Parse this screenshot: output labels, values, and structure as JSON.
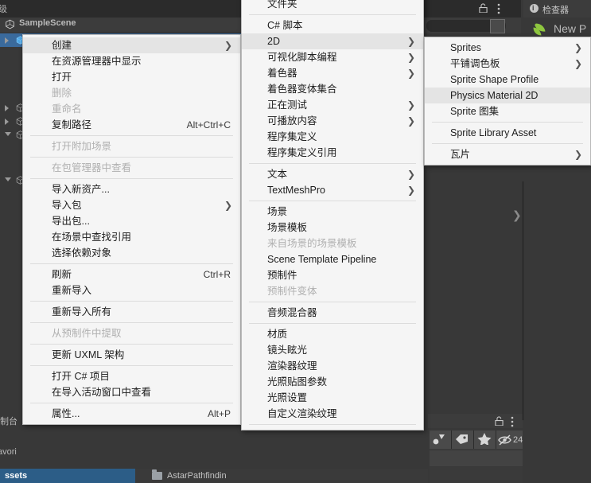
{
  "editor": {
    "left_tab_label": "级",
    "hierarchy": {
      "scene_name": "SampleScene",
      "scene_icon": "unity-logo-icon"
    },
    "inspector": {
      "tab_label": "检查器",
      "asset_name": "New P",
      "info_icon": "info-icon",
      "asset_icon": "sprite-asset-icon"
    },
    "project": {
      "hidden_count": "24",
      "lock_icon": "unlock-icon",
      "menu_icon": "kebab-menu-icon"
    },
    "breadcrumb": {
      "root": "ssets",
      "folder": "AstarPathfindin"
    },
    "console_label": "制台",
    "favorites_label": "avori"
  },
  "colors": {
    "menu_bg": "#f5f5f5",
    "menu_highlight": "#e4e4e4",
    "menu_border": "#b9b9b9",
    "editor_bg": "#383838",
    "panel_header": "#3c3c3c",
    "selection_blue": "#3a6a9c",
    "breadcrumb_blue": "#2c5d87",
    "accent_green": "#a6e22e"
  },
  "menu_assets": {
    "name": "assets-context-menu",
    "items": [
      {
        "label": "创建",
        "shortcut": "",
        "arrow": true,
        "disabled": false,
        "highlighted": true
      },
      {
        "label": "在资源管理器中显示",
        "shortcut": "",
        "arrow": false,
        "disabled": false,
        "highlighted": false
      },
      {
        "label": "打开",
        "shortcut": "",
        "arrow": false,
        "disabled": false,
        "highlighted": false
      },
      {
        "label": "删除",
        "shortcut": "",
        "arrow": false,
        "disabled": true,
        "highlighted": false
      },
      {
        "label": "重命名",
        "shortcut": "",
        "arrow": false,
        "disabled": true,
        "highlighted": false
      },
      {
        "label": "复制路径",
        "shortcut": "Alt+Ctrl+C",
        "arrow": false,
        "disabled": false,
        "highlighted": false
      },
      {
        "separator": true
      },
      {
        "label": "打开附加场景",
        "shortcut": "",
        "arrow": false,
        "disabled": true,
        "highlighted": false
      },
      {
        "separator": true
      },
      {
        "label": "在包管理器中查看",
        "shortcut": "",
        "arrow": false,
        "disabled": true,
        "highlighted": false
      },
      {
        "separator": true
      },
      {
        "label": "导入新资产...",
        "shortcut": "",
        "arrow": false,
        "disabled": false,
        "highlighted": false
      },
      {
        "label": "导入包",
        "shortcut": "",
        "arrow": true,
        "disabled": false,
        "highlighted": false
      },
      {
        "label": "导出包...",
        "shortcut": "",
        "arrow": false,
        "disabled": false,
        "highlighted": false
      },
      {
        "label": "在场景中查找引用",
        "shortcut": "",
        "arrow": false,
        "disabled": false,
        "highlighted": false
      },
      {
        "label": "选择依赖对象",
        "shortcut": "",
        "arrow": false,
        "disabled": false,
        "highlighted": false
      },
      {
        "separator": true
      },
      {
        "label": "刷新",
        "shortcut": "Ctrl+R",
        "arrow": false,
        "disabled": false,
        "highlighted": false
      },
      {
        "label": "重新导入",
        "shortcut": "",
        "arrow": false,
        "disabled": false,
        "highlighted": false
      },
      {
        "separator": true
      },
      {
        "label": "重新导入所有",
        "shortcut": "",
        "arrow": false,
        "disabled": false,
        "highlighted": false
      },
      {
        "separator": true
      },
      {
        "label": "从预制件中提取",
        "shortcut": "",
        "arrow": false,
        "disabled": true,
        "highlighted": false
      },
      {
        "separator": true
      },
      {
        "label": "更新 UXML 架构",
        "shortcut": "",
        "arrow": false,
        "disabled": false,
        "highlighted": false
      },
      {
        "separator": true
      },
      {
        "label": "打开 C# 项目",
        "shortcut": "",
        "arrow": false,
        "disabled": false,
        "highlighted": false
      },
      {
        "label": "在导入活动窗口中查看",
        "shortcut": "",
        "arrow": false,
        "disabled": false,
        "highlighted": false
      },
      {
        "separator": true
      },
      {
        "label": "属性...",
        "shortcut": "Alt+P",
        "arrow": false,
        "disabled": false,
        "highlighted": false
      }
    ]
  },
  "menu_create": {
    "name": "create-submenu",
    "items": [
      {
        "label": "文件夹",
        "shortcut": "",
        "arrow": false,
        "disabled": false,
        "highlighted": false
      },
      {
        "separator": true
      },
      {
        "label": "C# 脚本",
        "shortcut": "",
        "arrow": false,
        "disabled": false,
        "highlighted": false
      },
      {
        "label": "2D",
        "shortcut": "",
        "arrow": true,
        "disabled": false,
        "highlighted": true
      },
      {
        "label": "可视化脚本编程",
        "shortcut": "",
        "arrow": true,
        "disabled": false,
        "highlighted": false
      },
      {
        "label": "着色器",
        "shortcut": "",
        "arrow": true,
        "disabled": false,
        "highlighted": false
      },
      {
        "label": "着色器变体集合",
        "shortcut": "",
        "arrow": false,
        "disabled": false,
        "highlighted": false
      },
      {
        "label": "正在测试",
        "shortcut": "",
        "arrow": true,
        "disabled": false,
        "highlighted": false
      },
      {
        "label": "可播放内容",
        "shortcut": "",
        "arrow": true,
        "disabled": false,
        "highlighted": false
      },
      {
        "label": "程序集定义",
        "shortcut": "",
        "arrow": false,
        "disabled": false,
        "highlighted": false
      },
      {
        "label": "程序集定义引用",
        "shortcut": "",
        "arrow": false,
        "disabled": false,
        "highlighted": false
      },
      {
        "separator": true
      },
      {
        "label": "文本",
        "shortcut": "",
        "arrow": true,
        "disabled": false,
        "highlighted": false
      },
      {
        "label": "TextMeshPro",
        "shortcut": "",
        "arrow": true,
        "disabled": false,
        "highlighted": false
      },
      {
        "separator": true
      },
      {
        "label": "场景",
        "shortcut": "",
        "arrow": false,
        "disabled": false,
        "highlighted": false
      },
      {
        "label": "场景模板",
        "shortcut": "",
        "arrow": false,
        "disabled": false,
        "highlighted": false
      },
      {
        "label": "来自场景的场景模板",
        "shortcut": "",
        "arrow": false,
        "disabled": true,
        "highlighted": false
      },
      {
        "label": "Scene Template Pipeline",
        "shortcut": "",
        "arrow": false,
        "disabled": false,
        "highlighted": false
      },
      {
        "label": "预制件",
        "shortcut": "",
        "arrow": false,
        "disabled": false,
        "highlighted": false
      },
      {
        "label": "预制件变体",
        "shortcut": "",
        "arrow": false,
        "disabled": true,
        "highlighted": false
      },
      {
        "separator": true
      },
      {
        "label": "音频混合器",
        "shortcut": "",
        "arrow": false,
        "disabled": false,
        "highlighted": false
      },
      {
        "separator": true
      },
      {
        "label": "材质",
        "shortcut": "",
        "arrow": false,
        "disabled": false,
        "highlighted": false
      },
      {
        "label": "镜头眩光",
        "shortcut": "",
        "arrow": false,
        "disabled": false,
        "highlighted": false
      },
      {
        "label": "渲染器纹理",
        "shortcut": "",
        "arrow": false,
        "disabled": false,
        "highlighted": false
      },
      {
        "label": "光照贴图参数",
        "shortcut": "",
        "arrow": false,
        "disabled": false,
        "highlighted": false
      },
      {
        "label": "光照设置",
        "shortcut": "",
        "arrow": false,
        "disabled": false,
        "highlighted": false
      },
      {
        "label": "自定义渲染纹理",
        "shortcut": "",
        "arrow": false,
        "disabled": false,
        "highlighted": false
      },
      {
        "separator": true
      }
    ]
  },
  "menu_2d": {
    "name": "2d-submenu",
    "items": [
      {
        "label": "Sprites",
        "shortcut": "",
        "arrow": true,
        "disabled": false,
        "highlighted": false
      },
      {
        "label": "平铺调色板",
        "shortcut": "",
        "arrow": true,
        "disabled": false,
        "highlighted": false
      },
      {
        "label": "Sprite Shape Profile",
        "shortcut": "",
        "arrow": false,
        "disabled": false,
        "highlighted": false
      },
      {
        "label": "Physics Material 2D",
        "shortcut": "",
        "arrow": false,
        "disabled": false,
        "highlighted": true
      },
      {
        "label": "Sprite 图集",
        "shortcut": "",
        "arrow": false,
        "disabled": false,
        "highlighted": false
      },
      {
        "separator": true
      },
      {
        "label": "Sprite Library Asset",
        "shortcut": "",
        "arrow": false,
        "disabled": false,
        "highlighted": false
      },
      {
        "separator": true
      },
      {
        "label": "瓦片",
        "shortcut": "",
        "arrow": true,
        "disabled": false,
        "highlighted": false
      }
    ]
  },
  "hierarchy_rows": [
    {
      "indent": 1,
      "expander": "closed",
      "selected": true
    },
    {
      "indent": 2,
      "expander": "none",
      "selected": false
    },
    {
      "indent": 2,
      "expander": "none",
      "selected": false
    },
    {
      "indent": 2,
      "expander": "none",
      "selected": false
    },
    {
      "indent": 2,
      "expander": "none",
      "selected": false
    },
    {
      "indent": 1,
      "expander": "closed",
      "selected": false
    },
    {
      "indent": 1,
      "expander": "closed",
      "selected": false
    },
    {
      "indent": 1,
      "expander": "open",
      "selected": false
    }
  ]
}
